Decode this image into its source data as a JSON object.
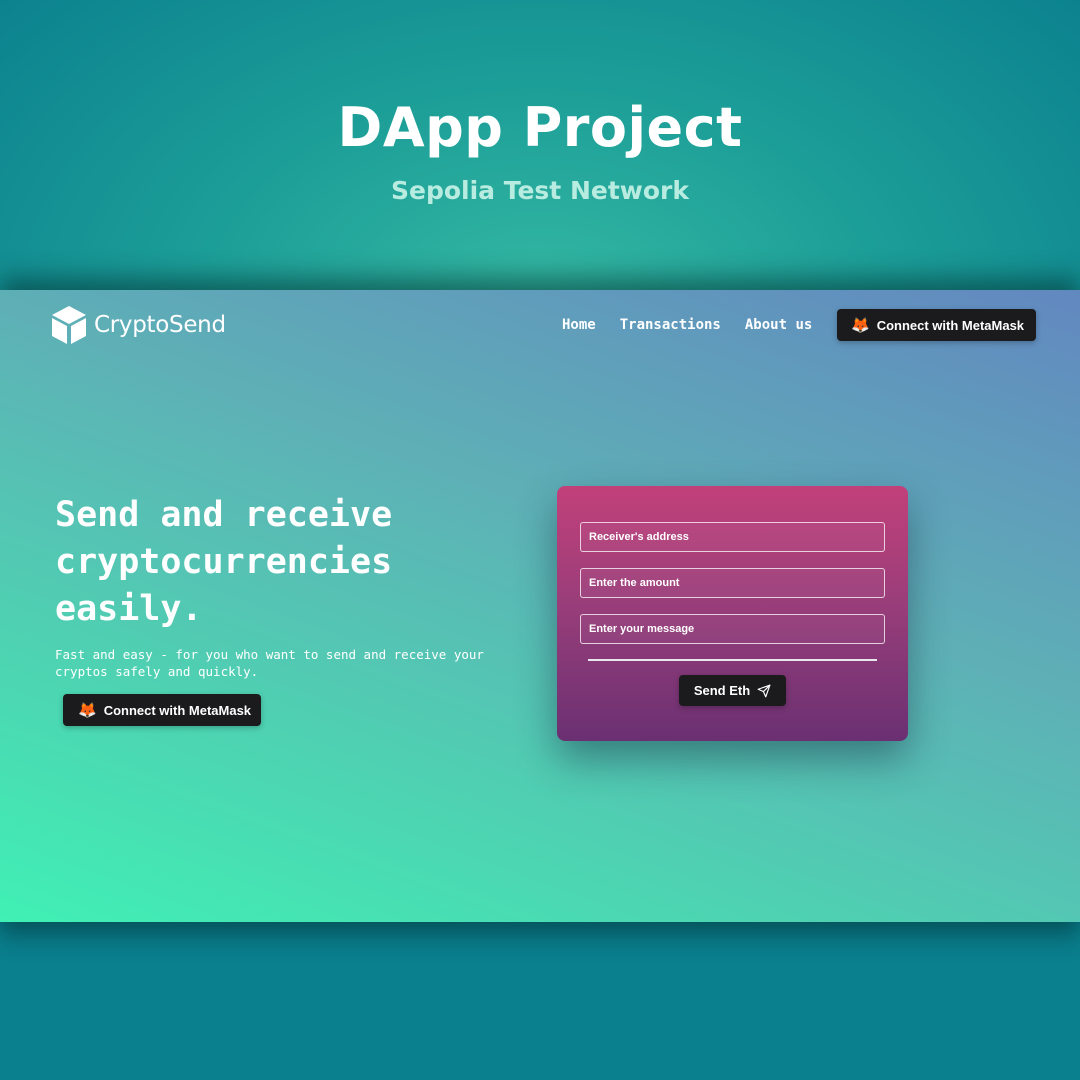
{
  "poster": {
    "title": "DApp Project",
    "subtitle": "Sepolia Test Network"
  },
  "nav": {
    "brand": "CryptoSend",
    "links": [
      "Home",
      "Transactions",
      "About us"
    ],
    "connect_label": "Connect with MetaMask"
  },
  "hero": {
    "title": "Send and receive cryptocurrencies easily.",
    "description": "Fast and easy - for you who want to send and receive your cryptos safely and quickly.",
    "connect_label": "Connect with MetaMask"
  },
  "form": {
    "receiver_placeholder": "Receiver's address",
    "amount_placeholder": "Enter the amount",
    "message_placeholder": "Enter your message",
    "send_label": "Send Eth"
  },
  "colors": {
    "button_bg": "#1b1b1d",
    "card_top": "#c2407a",
    "card_bottom": "#6a3072"
  },
  "icons": {
    "logo": "cube-icon",
    "metamask": "metamask-fox-icon",
    "send": "paper-plane-icon"
  }
}
